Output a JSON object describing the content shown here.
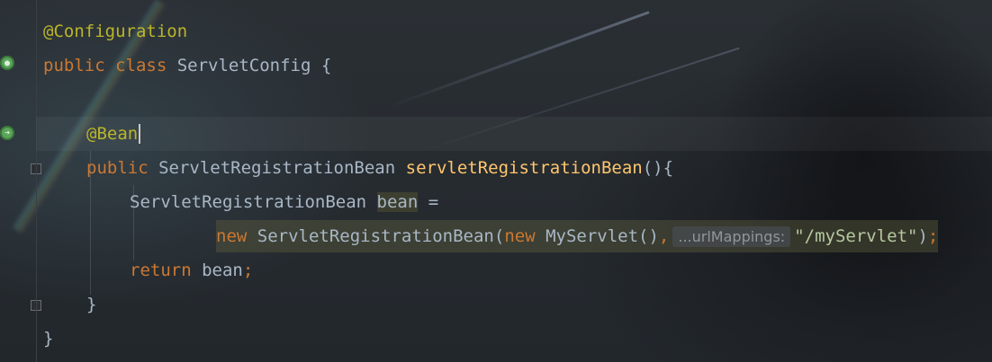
{
  "editor": {
    "lines": [
      {
        "id": "l1",
        "parts": [
          {
            "cls": "ann",
            "t": "@Configuration"
          }
        ]
      },
      {
        "id": "l2",
        "parts": [
          {
            "cls": "kw",
            "t": "public class "
          },
          {
            "cls": "plain",
            "t": "ServletConfig {"
          }
        ]
      },
      {
        "id": "l3",
        "parts": []
      },
      {
        "id": "l4",
        "parts": [
          {
            "cls": "ann",
            "t": "@Bean"
          }
        ]
      },
      {
        "id": "l5",
        "parts": [
          {
            "cls": "kw",
            "t": "public "
          },
          {
            "cls": "plain",
            "t": "ServletRegistrationBean "
          },
          {
            "cls": "fn",
            "t": "servletRegistrationBean"
          },
          {
            "cls": "plain",
            "t": "(){"
          }
        ]
      },
      {
        "id": "l6",
        "parts": [
          {
            "cls": "plain",
            "t": "ServletRegistrationBean "
          },
          {
            "cls": "plain",
            "t": "bean"
          },
          {
            "cls": "plain",
            "t": " ="
          }
        ]
      },
      {
        "id": "l7",
        "parts": [
          {
            "cls": "kw",
            "t": "new "
          },
          {
            "cls": "plain",
            "t": "ServletRegistrationBean("
          },
          {
            "cls": "kw",
            "t": "new "
          },
          {
            "cls": "plain",
            "t": "MyServlet()"
          },
          {
            "cls": "kw",
            "t": ","
          },
          {
            "cls": "hint",
            "t": "...urlMappings:"
          },
          {
            "cls": "str",
            "t": "\"/myServlet\""
          },
          {
            "cls": "plain",
            "t": ")"
          },
          {
            "cls": "kw",
            "t": ";"
          }
        ]
      },
      {
        "id": "l8",
        "parts": [
          {
            "cls": "kw",
            "t": "return "
          },
          {
            "cls": "plain",
            "t": "bean"
          },
          {
            "cls": "kw",
            "t": ";"
          }
        ]
      },
      {
        "id": "l9",
        "parts": [
          {
            "cls": "plain",
            "t": "}"
          }
        ]
      },
      {
        "id": "l10",
        "parts": [
          {
            "cls": "plain",
            "t": "}"
          }
        ]
      }
    ]
  },
  "colors": {
    "annotation": "#bbb529",
    "keyword": "#cc7832",
    "method": "#ffc66d",
    "identifier": "#a9b7c6",
    "string": "#b5c8a0",
    "hint": "#8f969c"
  },
  "icons": [
    "spring-bean-config-icon",
    "spring-bean-method-icon",
    "fold-open-icon",
    "fold-close-icon"
  ]
}
